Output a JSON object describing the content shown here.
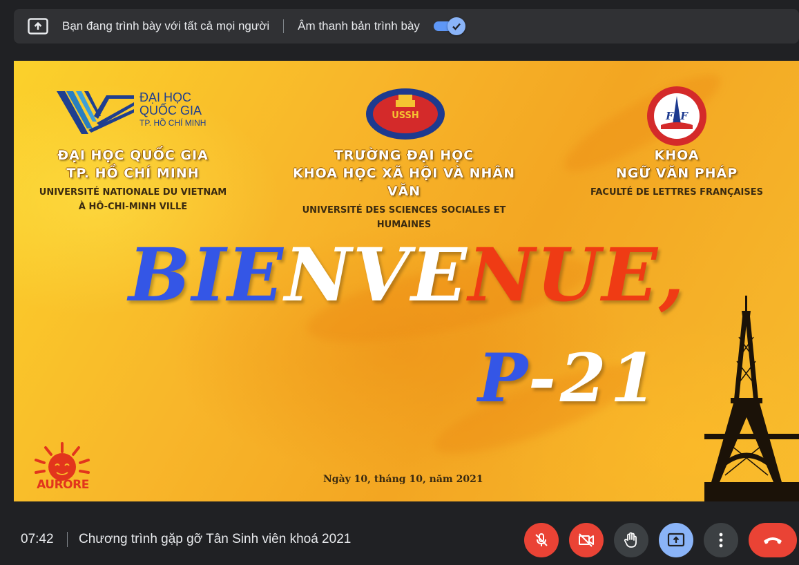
{
  "banner": {
    "presenting_text": "Bạn đang trình bày với tất cả mọi người",
    "audio_label": "Âm thanh bản trình bày",
    "audio_toggle_on": true
  },
  "slide": {
    "vnu_logo": {
      "line1": "ĐẠI HỌC",
      "line2": "QUỐC GIA",
      "line3": "TP. HỒ CHÍ MINH"
    },
    "ussh_logo_text": "USSH",
    "flf_logo_text": "FLF",
    "left": {
      "title1": "ĐẠI HỌC QUỐC GIA",
      "title2": "TP. HỒ CHÍ MINH",
      "sub1": "UNIVERSITÉ NATIONALE DU VIETNAM",
      "sub2": "À HÔ-CHI-MINH VILLE"
    },
    "middle": {
      "title1": "TRƯỜNG ĐẠI HỌC",
      "title2": "KHOA HỌC XÃ HỘI VÀ NHÂN VĂN",
      "sub1": "UNIVERSITÉ DES SCIENCES SOCIALES ET HUMAINES"
    },
    "right": {
      "title1": "KHOA",
      "title2": "NGỮ VĂN PHÁP",
      "sub1": "FACULTÉ DE LETTRES FRANÇAISES"
    },
    "headline": {
      "part_blue": "BIE",
      "part_white": "NVE",
      "part_red": "NUE,"
    },
    "class": {
      "part_blue": "P",
      "part_white": "-",
      "part_white2": "21"
    },
    "date": "Ngày 10, tháng 10, năm 2021",
    "aurore_label": "AURORE",
    "colors": {
      "blue": "#3456e6",
      "red": "#ef3b14",
      "white": "#ffffff",
      "bg": "#f8b62a"
    }
  },
  "bottom_bar": {
    "clock": "07:42",
    "meeting_title": "Chương trình gặp gỡ Tân Sinh viên khoá 2021",
    "controls": [
      {
        "name": "microphone-off",
        "icon": "mic-off-icon"
      },
      {
        "name": "camera-off",
        "icon": "videocam-off-icon"
      },
      {
        "name": "raise-hand",
        "icon": "hand-icon"
      },
      {
        "name": "present-now",
        "icon": "present-icon"
      },
      {
        "name": "more-options",
        "icon": "more-vert-icon"
      },
      {
        "name": "leave-call",
        "icon": "call-end-icon"
      }
    ]
  }
}
